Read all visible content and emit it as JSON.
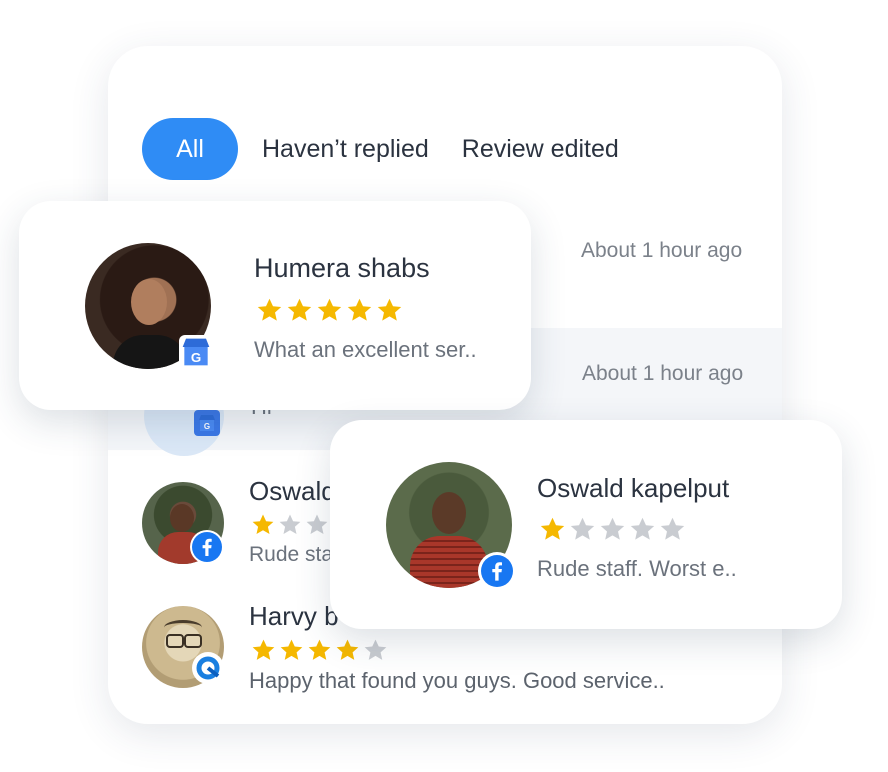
{
  "tabs": [
    {
      "label": "All",
      "active": true
    },
    {
      "label": "Haven’t replied",
      "active": false
    },
    {
      "label": "Review edited",
      "active": false
    }
  ],
  "list": {
    "row1_time": "About 1 hour ago",
    "row2_time": "About 1 hour ago",
    "row2_partial": "Hi",
    "row3": {
      "name": "Oswald kapelput",
      "rating": 1,
      "snippet": "Rude staff. Worst e..",
      "source_icon": "facebook-icon"
    },
    "row4": {
      "name": "Harvy b",
      "rating": 4,
      "snippet": "Happy that  found you guys. Good service..",
      "source_icon": "app-badge-icon"
    }
  },
  "card_humera": {
    "name": "Humera shabs",
    "rating": 5,
    "snippet": "What an excellent ser..",
    "source_icon": "google-business-icon"
  },
  "card_oswald": {
    "name": "Oswald kapelput",
    "rating": 1,
    "snippet": "Rude staff. Worst e..",
    "source_icon": "facebook-icon"
  },
  "colors": {
    "accent": "#2f8cf5",
    "star": "#f5b800",
    "star_empty": "#c9ccd1",
    "facebook": "#1877f2"
  }
}
